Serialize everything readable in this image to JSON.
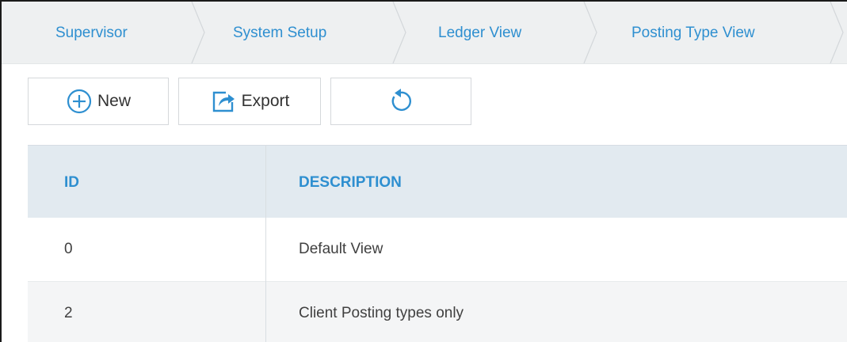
{
  "breadcrumb": {
    "items": [
      {
        "label": "Supervisor"
      },
      {
        "label": "System Setup"
      },
      {
        "label": "Ledger View"
      },
      {
        "label": "Posting Type View"
      }
    ]
  },
  "toolbar": {
    "new_label": "New",
    "export_label": "Export",
    "refresh_icon": "refresh-icon"
  },
  "table": {
    "columns": [
      "ID",
      "DESCRIPTION"
    ],
    "rows": [
      {
        "id": "0",
        "description": "Default View"
      },
      {
        "id": "2",
        "description": "Client Posting types only"
      }
    ]
  },
  "colors": {
    "accent": "#2e8fd0",
    "header_bg": "#e2eaf0",
    "breadcrumb_bg": "#eef0f1"
  }
}
